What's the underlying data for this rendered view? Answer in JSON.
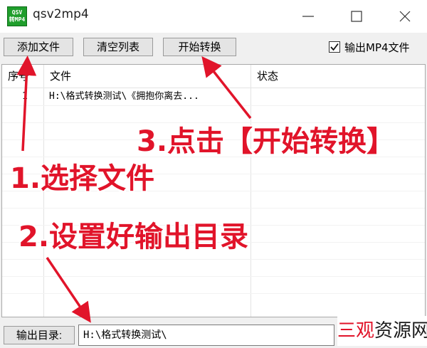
{
  "window": {
    "title": "qsv2mp4",
    "icon_text_top": "QSV",
    "icon_text_bottom": "转MP4"
  },
  "toolbar": {
    "add_file_label": "添加文件",
    "clear_list_label": "清空列表",
    "start_label": "开始转换",
    "output_mp4_label": "输出MP4文件",
    "output_mp4_checked": true
  },
  "list": {
    "columns": [
      "序号",
      "文件",
      "状态"
    ],
    "rows": [
      {
        "index": "1",
        "file": "H:\\格式转换测试\\《拥抱你离去...",
        "status": ""
      }
    ]
  },
  "bottom": {
    "output_dir_label": "输出目录:",
    "output_dir_value": "H:\\格式转换测试\\"
  },
  "annotations": {
    "step1": "1.选择文件",
    "step2": "2.设置好输出目录",
    "step3": "3.点击【开始转换】",
    "color": "#e1142a"
  },
  "watermark": {
    "part_a": "三观",
    "part_b": "资源网"
  }
}
